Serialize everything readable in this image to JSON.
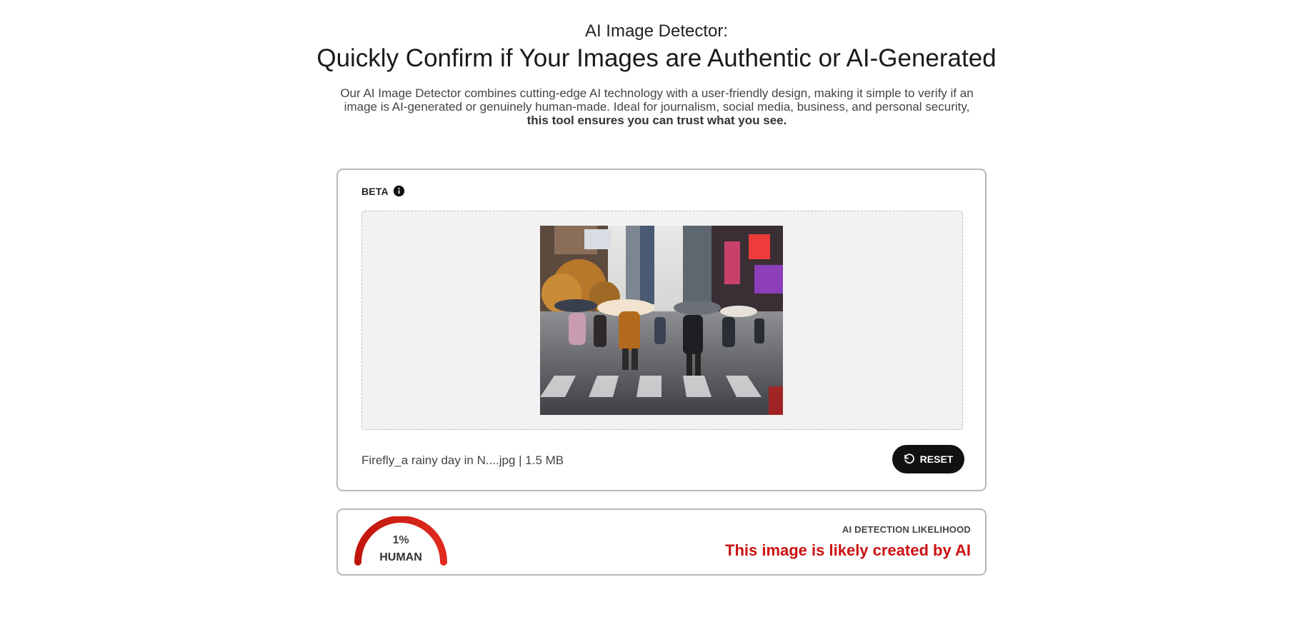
{
  "hero": {
    "eyebrow": "AI Image Detector:",
    "headline": "Quickly Confirm if Your Images are Authentic or AI-Generated",
    "lead_text": "Our AI Image Detector combines cutting-edge AI technology with a user-friendly design, making it simple to verify if an image is AI-generated or genuinely human-made. Ideal for journalism, social media, business, and personal security,",
    "lead_strong": "this tool ensures you can trust what you see."
  },
  "upload": {
    "badge": "BETA",
    "badge_icon": "info-icon",
    "file_name": "Firefly_a rainy day in N....jpg | 1.5 MB",
    "reset_label": "RESET",
    "reset_icon": "rotate-ccw-icon"
  },
  "result": {
    "gauge_percent": "1%",
    "gauge_value": 0.01,
    "gauge_label": "HUMAN",
    "likelihood_title": "AI DETECTION LIKELIHOOD",
    "verdict": "This image is likely created by AI"
  },
  "colors": {
    "accent": "#111111",
    "danger": "#cc1111",
    "gauge_start": "#c0160d",
    "gauge_end": "#e02a1e"
  }
}
